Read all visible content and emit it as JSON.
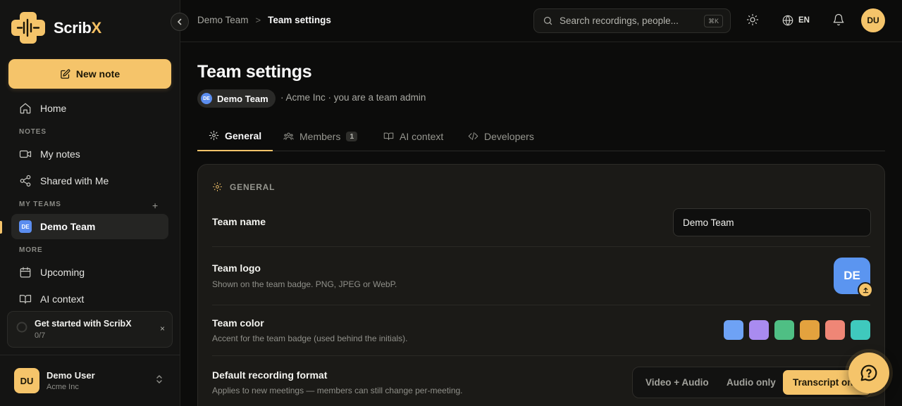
{
  "brand": {
    "name_main": "Scrib",
    "name_accent": "X",
    "accent": "#f5c46a"
  },
  "sidebar": {
    "new_note_label": "New note",
    "home_label": "Home",
    "notes_section": "NOTES",
    "my_notes_label": "My notes",
    "shared_label": "Shared with Me",
    "teams_section": "MY TEAMS",
    "add_team_symbol": "+",
    "team_initials": "DE",
    "team_label": "Demo Team",
    "more_section": "MORE",
    "upcoming_label": "Upcoming",
    "ai_context_label": "AI context",
    "get_started": {
      "title": "Get started with ScribX",
      "progress": "0/7",
      "close": "×"
    },
    "user": {
      "initials": "DU",
      "name": "Demo User",
      "org": "Acme Inc"
    }
  },
  "topbar": {
    "breadcrumb": {
      "parent": "Demo Team",
      "separator": ">",
      "current": "Team settings"
    },
    "search_placeholder": "Search recordings, people...",
    "search_shortcut": "⌘K",
    "language": "EN",
    "avatar_initials": "DU"
  },
  "page": {
    "title": "Team settings",
    "team_pill_initials": "DE",
    "team_pill_label": "Demo Team",
    "meta": "· Acme Inc · you are a team admin",
    "tabs": [
      {
        "label": "General",
        "active": true
      },
      {
        "label": "Members",
        "count": "1"
      },
      {
        "label": "AI context"
      },
      {
        "label": "Developers"
      }
    ]
  },
  "general": {
    "heading": "GENERAL",
    "team_name": {
      "label": "Team name",
      "value": "Demo Team"
    },
    "team_logo": {
      "label": "Team logo",
      "help": "Shown on the team badge. PNG, JPEG or WebP.",
      "initials": "DE",
      "color": "#5b95f0"
    },
    "team_color": {
      "label": "Team color",
      "help": "Accent for the team badge (used behind the initials).",
      "swatches": [
        "#6ea2f5",
        "#a98bf0",
        "#4fbf84",
        "#e3a23e",
        "#ef8676",
        "#3fc9bd"
      ]
    },
    "recording_format": {
      "label": "Default recording format",
      "help": "Applies to new meetings — members can still change per-meeting.",
      "options": [
        "Video + Audio",
        "Audio only",
        "Transcript only"
      ],
      "selected": "Transcript only"
    }
  }
}
